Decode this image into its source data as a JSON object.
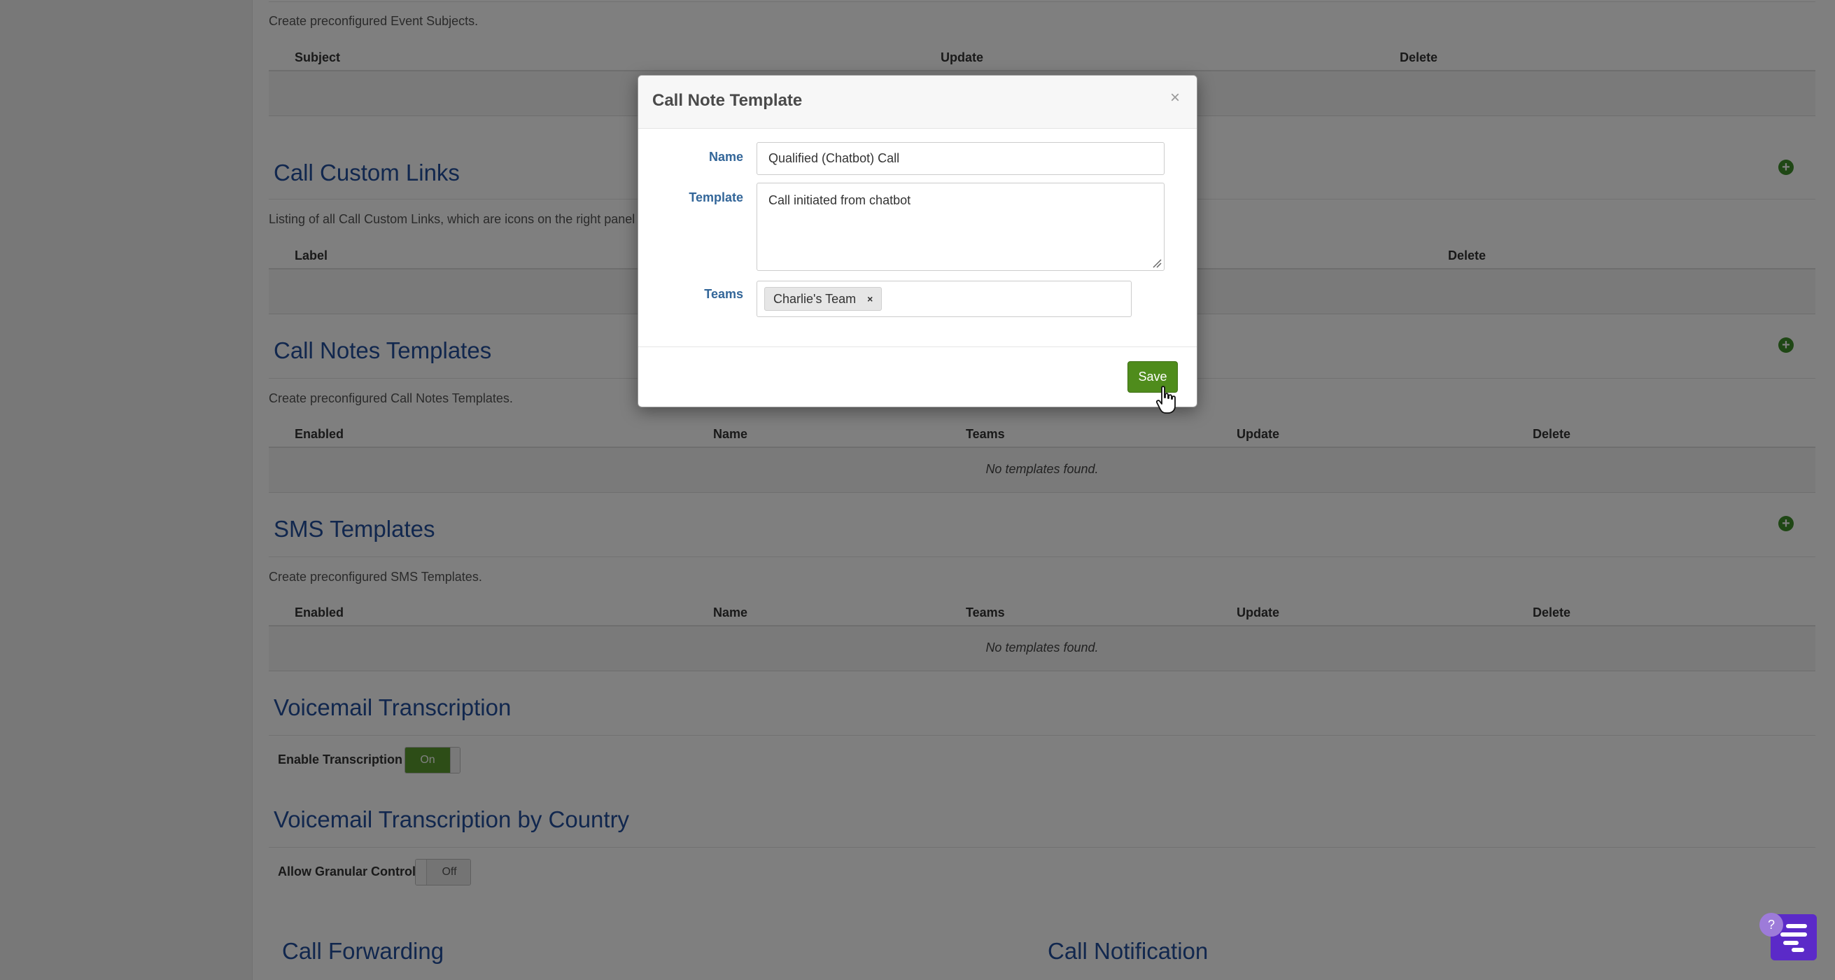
{
  "sections": {
    "event_subjects": {
      "description": "Create preconfigured Event Subjects.",
      "columns": [
        "Subject",
        "Update",
        "Delete"
      ]
    },
    "call_custom_links": {
      "title": "Call Custom Links",
      "description": "Listing of all Call Custom Links, which are icons on the right panel",
      "columns": [
        "Label",
        "Delete"
      ]
    },
    "call_notes_templates": {
      "title": "Call Notes Templates",
      "description": "Create preconfigured Call Notes Templates.",
      "columns": [
        "Enabled",
        "Name",
        "Teams",
        "Update",
        "Delete"
      ],
      "empty_message": "No templates found."
    },
    "sms_templates": {
      "title": "SMS Templates",
      "description": "Create preconfigured SMS Templates.",
      "columns": [
        "Enabled",
        "Name",
        "Teams",
        "Update",
        "Delete"
      ],
      "empty_message": "No templates found."
    },
    "voicemail_transcription": {
      "title": "Voicemail Transcription",
      "label": "Enable Transcription",
      "toggle_label": "On"
    },
    "voicemail_transcription_by_country": {
      "title": "Voicemail Transcription by Country",
      "label": "Allow Granular Control",
      "toggle_label": "Off"
    },
    "call_forwarding": {
      "title": "Call Forwarding"
    },
    "call_notification": {
      "title": "Call Notification"
    }
  },
  "modal": {
    "title": "Call Note Template",
    "close_glyph": "×",
    "name_label": "Name",
    "name_value": "Qualified (Chatbot) Call",
    "template_label": "Template",
    "template_value": "Call initiated from chatbot",
    "teams_label": "Teams",
    "team_tag": "Charlie's Team",
    "tag_remove_glyph": "×",
    "save_label": "Save"
  },
  "widgets": {
    "help_glyph": "?"
  },
  "icons": {
    "add": "plus-circle-icon",
    "close": "close-icon",
    "cursor": "hand-pointer-icon",
    "chat": "chat-widget-icon"
  },
  "colors": {
    "heading_blue": "#224f9c",
    "save_green": "#4f8c1c",
    "add_green": "#3f8e2a",
    "toggle_on_green": "#5a9a2e",
    "chat_purple": "#5b2ac8"
  }
}
